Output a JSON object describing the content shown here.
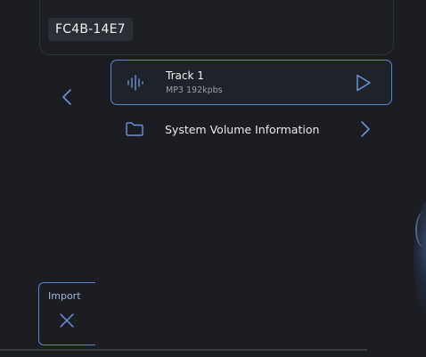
{
  "device": {
    "id": "FC4B-14E7"
  },
  "navigation": {
    "back_icon": "chevron-left-icon"
  },
  "tracks": [
    {
      "title": "Track 1",
      "meta": "MP3 192kpbs",
      "icon": "waveform-icon",
      "action_icon": "play-icon",
      "selected": true
    }
  ],
  "folders": [
    {
      "label": "System Volume Information",
      "icon": "folder-icon",
      "action_icon": "chevron-right-icon"
    }
  ],
  "import": {
    "label": "Import",
    "icon": "close-icon"
  },
  "colors": {
    "background": "#1b1d22",
    "accent": "#5b86cc",
    "chip": "#2b2e34",
    "text": "#e6e8ec",
    "muted": "#9aa0aa"
  }
}
